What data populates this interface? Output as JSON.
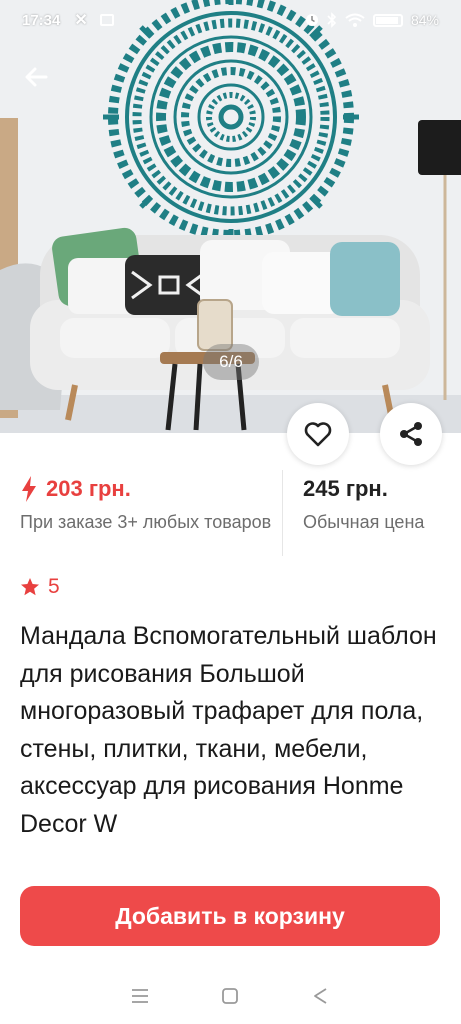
{
  "status_bar": {
    "time": "17:34",
    "x_icon": "✕",
    "battery": "84%"
  },
  "gallery": {
    "counter": "6/6"
  },
  "price": {
    "deal_value": "203 грн.",
    "deal_note": "При заказе 3+ любых товаров",
    "regular_value": "245 грн.",
    "regular_note": "Обычная цена"
  },
  "rating": {
    "value": "5"
  },
  "product": {
    "title": "Мандала Вспомогательный шаблон для рисования Большой многоразовый трафарет для пола, стены, плитки, ткани, мебели, аксессуар для рисования Honme Decor W"
  },
  "actions": {
    "add_to_cart": "Добавить в корзину"
  },
  "colors": {
    "accent": "#ee4a4a",
    "price_red": "#e8403f",
    "mandala": "#1f7f85"
  },
  "icons": [
    "arrow-left-icon",
    "heart-icon",
    "share-icon",
    "lightning-icon",
    "star-icon",
    "menu-icon",
    "home-square-icon",
    "back-triangle-icon"
  ]
}
